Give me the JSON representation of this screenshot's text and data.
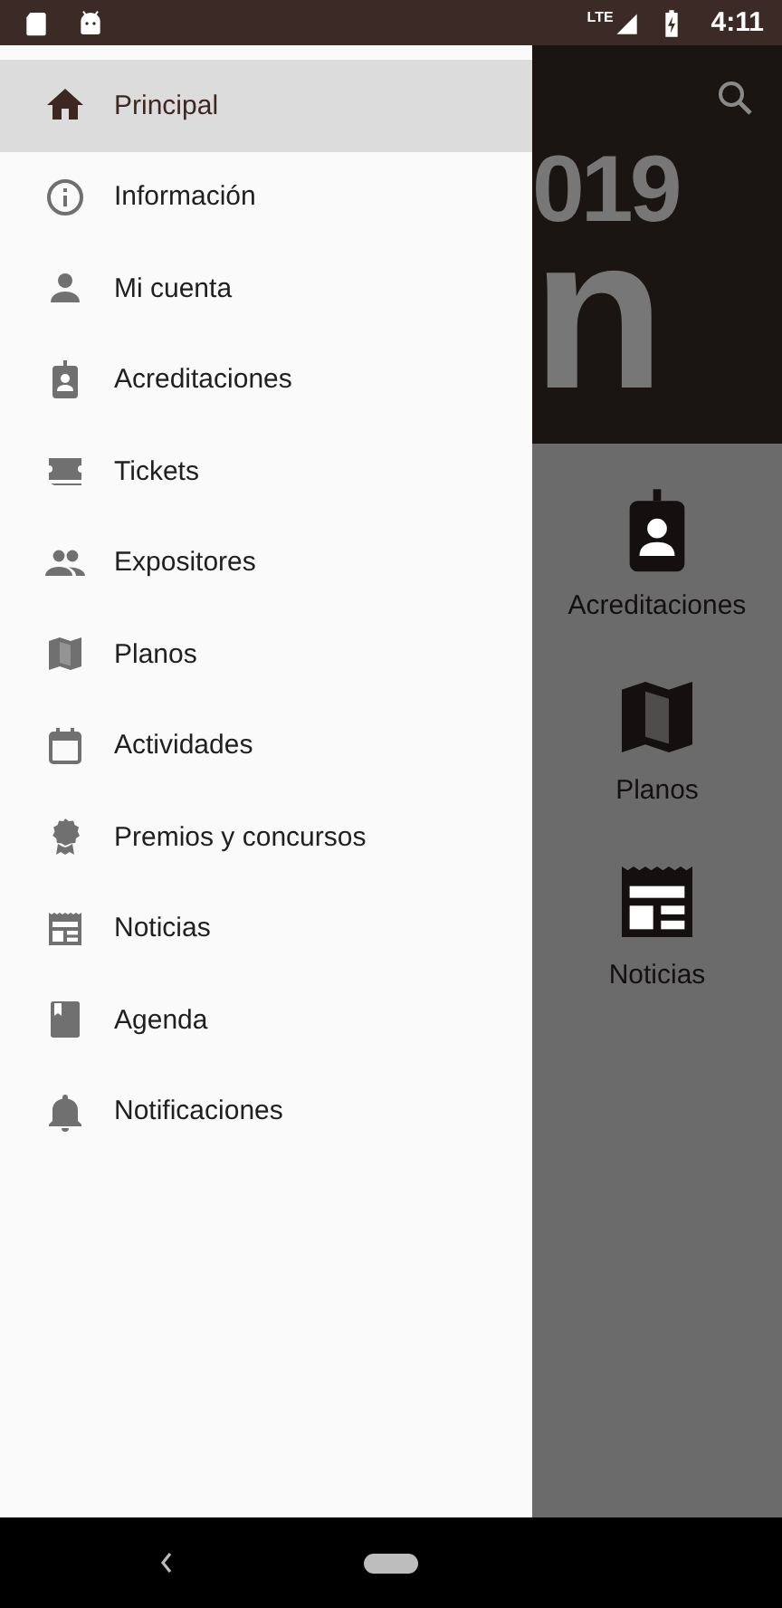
{
  "status_bar": {
    "time": "4:11",
    "network": "LTE"
  },
  "app": {
    "logo_lines": [
      "019",
      "n"
    ],
    "shortcuts": [
      {
        "label": "Acreditaciones",
        "kind": "badge"
      },
      {
        "label": "Planos",
        "kind": "map"
      },
      {
        "label": "Noticias",
        "kind": "news"
      }
    ]
  },
  "drawer": {
    "items": [
      {
        "label": "Principal",
        "kind": "home",
        "selected": true
      },
      {
        "label": "Información",
        "kind": "info",
        "selected": false
      },
      {
        "label": "Mi cuenta",
        "kind": "person",
        "selected": false
      },
      {
        "label": "Acreditaciones",
        "kind": "badge",
        "selected": false
      },
      {
        "label": "Tickets",
        "kind": "ticket",
        "selected": false
      },
      {
        "label": "Expositores",
        "kind": "group",
        "selected": false
      },
      {
        "label": "Planos",
        "kind": "map",
        "selected": false
      },
      {
        "label": "Actividades",
        "kind": "calendar",
        "selected": false
      },
      {
        "label": "Premios y concursos",
        "kind": "award",
        "selected": false
      },
      {
        "label": "Noticias",
        "kind": "news",
        "selected": false
      },
      {
        "label": "Agenda",
        "kind": "book",
        "selected": false
      },
      {
        "label": "Notificaciones",
        "kind": "bell",
        "selected": false
      }
    ]
  }
}
